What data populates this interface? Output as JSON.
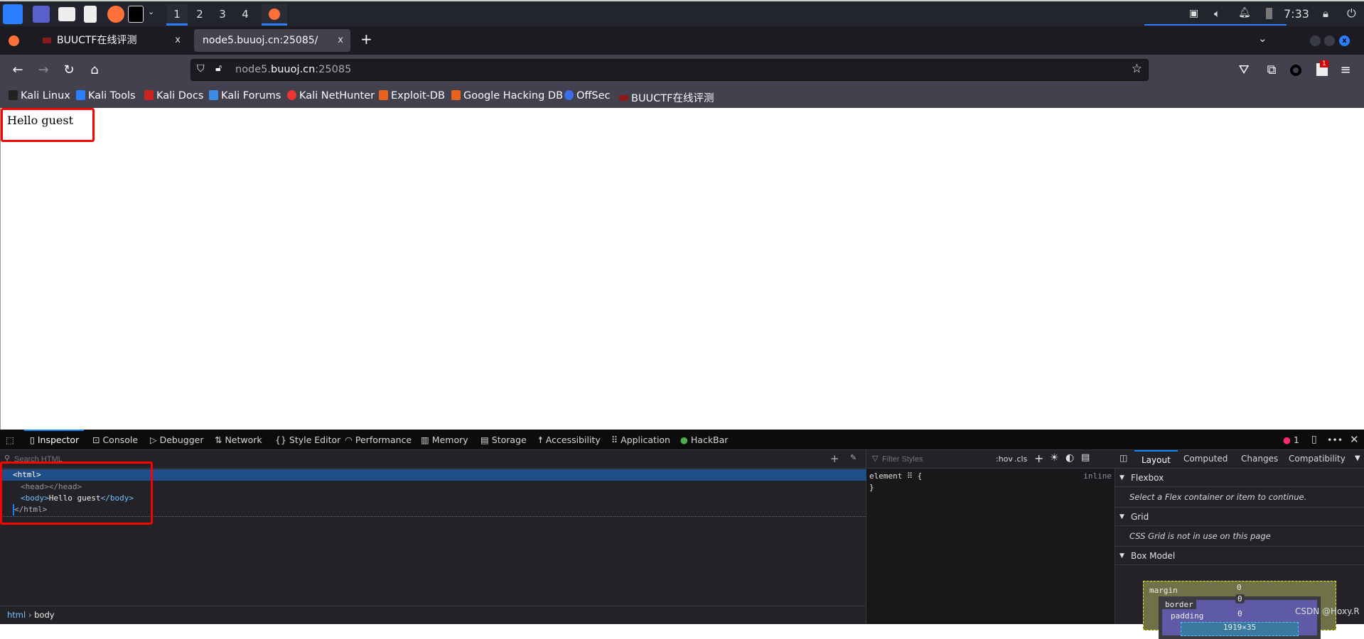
{
  "taskbar": {
    "workspaces": [
      "1",
      "2",
      "3",
      "4"
    ],
    "active_workspace": "1",
    "clock": "7:33",
    "accent": "#2a7fff"
  },
  "tabs": [
    {
      "label": "BUUCTF在线评测",
      "close": "x"
    },
    {
      "label": "node5.buuoj.cn:25085/",
      "close": "x",
      "active": true
    }
  ],
  "new_tab": "+",
  "url": {
    "host_prefix": "node5.",
    "host_domain": "buuoj.cn",
    "host_suffix": ":25085"
  },
  "extension_badge": "1",
  "bookmarks": [
    {
      "label": "Kali Linux",
      "icon": "kali-dragon"
    },
    {
      "label": "Kali Tools",
      "icon": "kali-tools"
    },
    {
      "label": "Kali Docs",
      "icon": "kali-docs"
    },
    {
      "label": "Kali Forums",
      "icon": "kali-forums"
    },
    {
      "label": "Kali NetHunter",
      "icon": "nethunter"
    },
    {
      "label": "Exploit-DB",
      "icon": "exploit-db"
    },
    {
      "label": "Google Hacking DB",
      "icon": "ghdb"
    },
    {
      "label": "OffSec",
      "icon": "offsec"
    },
    {
      "label": "BUUCTF在线评测",
      "icon": "buuctf"
    }
  ],
  "page": {
    "body_text": "Hello guest"
  },
  "devtools": {
    "tabs": [
      "Inspector",
      "Console",
      "Debugger",
      "Network",
      "Style Editor",
      "Performance",
      "Memory",
      "Storage",
      "Accessibility",
      "Application",
      "HackBar"
    ],
    "active_tab": "Inspector",
    "error_count": "1",
    "search_placeholder": "Search HTML",
    "markup": {
      "html_open": "<html>",
      "head": "<head></head>",
      "body_open": "<body>",
      "body_text": "Hello guest",
      "body_close": "</body>",
      "html_close": "</html>"
    },
    "breadcrumb": [
      "html",
      "body"
    ],
    "rules": {
      "filter_placeholder": "Filter Styles",
      "hov": ":hov",
      "cls": ".cls",
      "selector": "element",
      "open_brace": "{",
      "close_brace": "}",
      "source": "inline"
    },
    "layout_tabs": [
      "Layout",
      "Computed",
      "Changes",
      "Compatibility"
    ],
    "sections": {
      "flexbox": "Flexbox",
      "flexbox_note": "Select a Flex container or item to continue.",
      "grid": "Grid",
      "grid_note": "CSS Grid is not in use on this page",
      "box_model": "Box Model"
    },
    "box_model": {
      "margin_label": "margin",
      "border_label": "border",
      "padding_label": "padding",
      "margin_top": "0",
      "border_top": "0",
      "padding_top": "0",
      "content_size": "1919×35"
    }
  },
  "watermark": "CSDN @Hoxy.R"
}
